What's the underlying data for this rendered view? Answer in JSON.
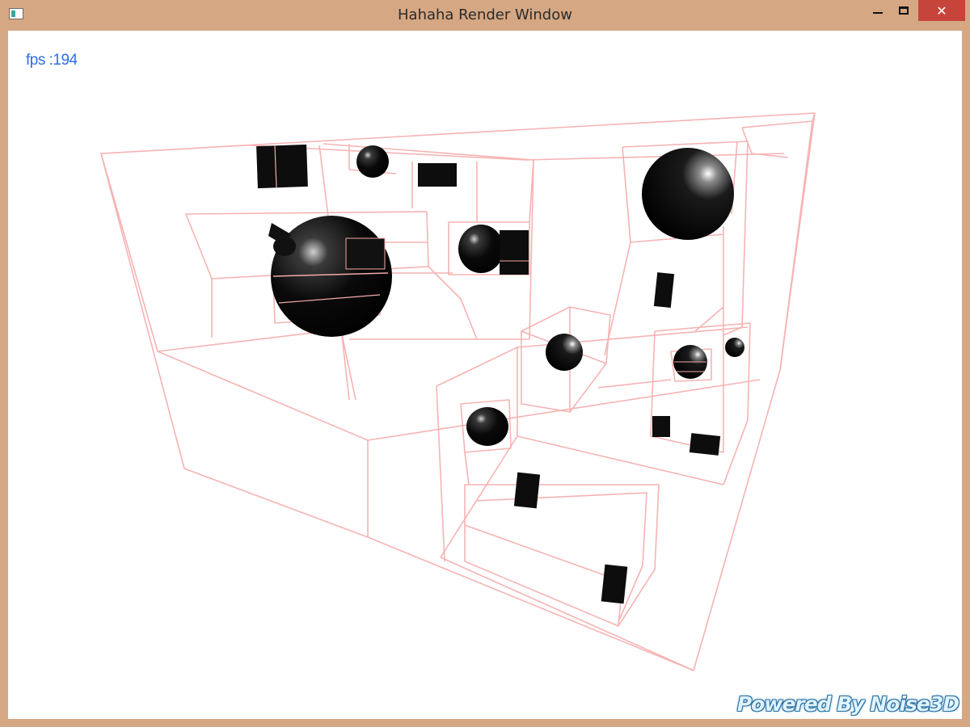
{
  "window": {
    "title": "Hahaha Render Window",
    "close_glyph": "✕",
    "icons": [
      "app-icon",
      "minimize-icon",
      "maximize-icon",
      "close-icon"
    ]
  },
  "viewport": {
    "fps_label": "fps :194",
    "watermark": "Powered By Noise3D"
  },
  "colors": {
    "frame": "#d6a783",
    "close_button": "#c7443a",
    "fps_text": "#2f6ee6",
    "wireframe": "#f4a9a9",
    "objects": "#0a0a0a",
    "background": "#ffffff"
  }
}
